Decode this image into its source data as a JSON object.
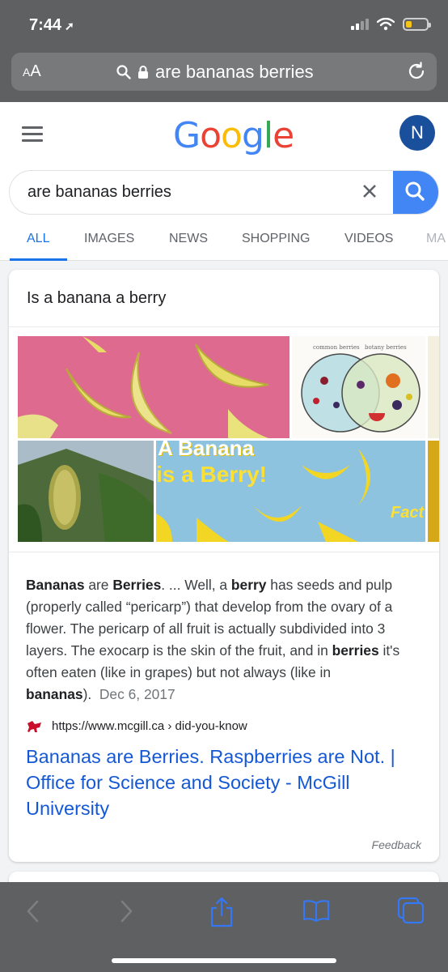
{
  "status_bar": {
    "time": "7:44",
    "location_arrow": "location-arrow-icon"
  },
  "url_bar": {
    "text_size_label": "AA",
    "url_text": "are bananas berries"
  },
  "google": {
    "logo_letters": [
      "G",
      "o",
      "o",
      "g",
      "l",
      "e"
    ],
    "logo_colors": [
      "#4285f4",
      "#ea4335",
      "#fbbc05",
      "#4285f4",
      "#34a853",
      "#ea4335"
    ],
    "avatar_initial": "N",
    "search_query": "are bananas berries"
  },
  "tabs": [
    "ALL",
    "IMAGES",
    "NEWS",
    "SHOPPING",
    "VIDEOS",
    "MA"
  ],
  "featured_snippet": {
    "title": "Is a banana a berry",
    "image_text_1": "common berries",
    "image_text_2": "botany berries",
    "image_text_3": "A Banana",
    "image_text_4": "is a Berry!",
    "image_text_5": "Fact",
    "snippet_parts": {
      "b1": "Bananas",
      "t1": " are ",
      "b2": "Berries",
      "t2": ". ... Well, a ",
      "b3": "berry",
      "t3": " has seeds and pulp (properly called “pericarp”) that develop from the ovary of a flower. The pericarp of all fruit is actually subdivided into 3 layers. The exocarp is the skin of the fruit, and in ",
      "b4": "berries",
      "t4": " it's often eaten (like in grapes) but not always (like in ",
      "b5": "bananas",
      "t5": ").",
      "date": "Dec 6, 2017"
    },
    "source_url": "https://www.mcgill.ca",
    "source_path": "› did-you-know",
    "link_title": "Bananas are Berries. Raspberries are Not. | Office for Science and Society - McGill University",
    "feedback": "Feedback"
  },
  "colors": {
    "accent_blue": "#1a73e8",
    "link_blue": "#1558d6",
    "chrome_gray": "#5f6062",
    "safari_blue": "#3478f6"
  },
  "toolbar_icons": [
    "back-icon",
    "forward-icon",
    "share-icon",
    "bookmarks-icon",
    "tabs-icon"
  ]
}
